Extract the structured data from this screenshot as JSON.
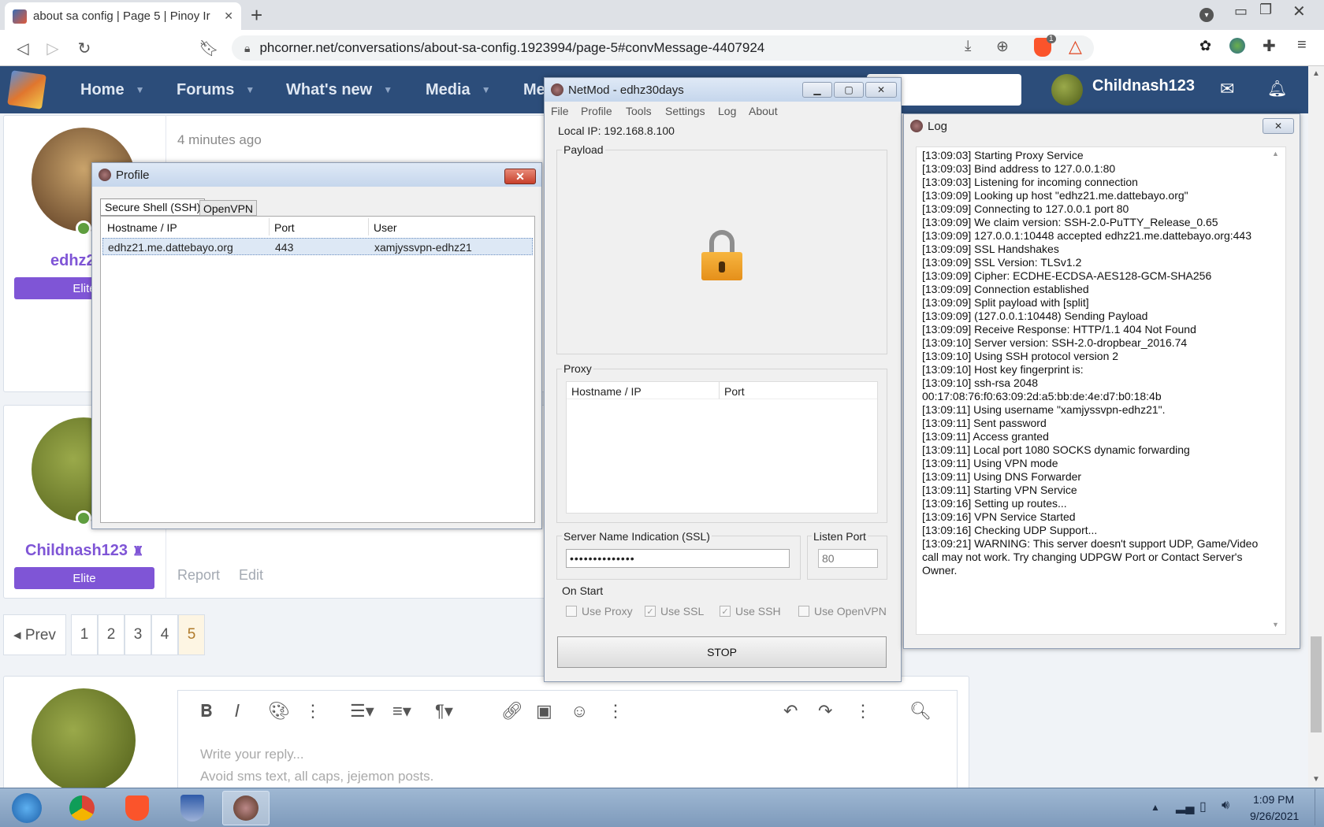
{
  "browser": {
    "tab_title": "about sa config | Page 5 | Pinoy Ir",
    "tab_close": "✕",
    "new_tab": "+",
    "url": "phcorner.net/conversations/about-sa-config.1923994/page-5#convMessage-4407924",
    "brave_count": "1"
  },
  "site": {
    "nav": [
      "Home",
      "Forums",
      "What's new",
      "Media",
      "Me"
    ],
    "username": "Childnash123",
    "post1": {
      "time": "4 minutes ago",
      "user": "edhz2",
      "badge": "Elite"
    },
    "post2": {
      "user": "Childnash123",
      "badge": "Elite",
      "actions": [
        "Report",
        "Edit"
      ]
    },
    "pagination": {
      "prev": "◂ Prev",
      "pages": [
        "1",
        "2",
        "3",
        "4",
        "5"
      ],
      "current": "5"
    },
    "editor": {
      "placeholder1": "Write your reply...",
      "placeholder2": "Avoid sms text, all caps, jejemon posts."
    }
  },
  "profile_window": {
    "title": "Profile",
    "tabs": [
      "Secure Shell (SSH)",
      "OpenVPN"
    ],
    "columns": [
      "Hostname / IP",
      "Port",
      "User"
    ],
    "rows": [
      {
        "host": "edhz21.me.dattebayo.org",
        "port": "443",
        "user": "xamjyssvpn-edhz21"
      }
    ]
  },
  "netmod_window": {
    "title": "NetMod - edhz30days",
    "menu": [
      "File",
      "Profile",
      "Tools",
      "Settings",
      "Log",
      "About"
    ],
    "local_ip": "Local IP: 192.168.8.100",
    "payload_label": "Payload",
    "proxy_label": "Proxy",
    "proxy_columns": [
      "Hostname / IP",
      "Port"
    ],
    "sni_label": "Server Name Indication (SSL)",
    "sni_value": "••••••••••••••",
    "listen_port_label": "Listen Port",
    "listen_port_placeholder": "80",
    "on_start_label": "On Start",
    "options": [
      {
        "label": "Use Proxy",
        "checked": false
      },
      {
        "label": "Use SSL",
        "checked": true
      },
      {
        "label": "Use SSH",
        "checked": true
      },
      {
        "label": "Use OpenVPN",
        "checked": false
      }
    ],
    "stop_label": "STOP"
  },
  "log_window": {
    "title": "Log",
    "lines": [
      "[13:09:03] Starting Proxy Service",
      "[13:09:03] Bind address to 127.0.0.1:80",
      "[13:09:03] Listening for incoming connection",
      "[13:09:09] Looking up host \"edhz21.me.dattebayo.org\"",
      "[13:09:09] Connecting to 127.0.0.1 port 80",
      "[13:09:09] We claim version: SSH-2.0-PuTTY_Release_0.65",
      "[13:09:09] 127.0.0.1:10448 accepted edhz21.me.dattebayo.org:443",
      "[13:09:09] SSL Handshakes",
      "[13:09:09] SSL Version: TLSv1.2",
      "[13:09:09] Cipher: ECDHE-ECDSA-AES128-GCM-SHA256",
      "[13:09:09] Connection established",
      "[13:09:09] Split payload with [split]",
      "[13:09:09] (127.0.0.1:10448) Sending Payload",
      "[13:09:09] Receive Response: HTTP/1.1 404 Not Found",
      "[13:09:10] Server version: SSH-2.0-dropbear_2016.74",
      "[13:09:10] Using SSH protocol version 2",
      "[13:09:10] Host key fingerprint is:",
      "[13:09:10] ssh-rsa 2048",
      "00:17:08:76:f0:63:09:2d:a5:bb:de:4e:d7:b0:18:4b",
      "[13:09:11] Using username \"xamjyssvpn-edhz21\".",
      "[13:09:11] Sent password",
      "[13:09:11] Access granted",
      "[13:09:11] Local port 1080 SOCKS dynamic forwarding",
      "[13:09:11] Using VPN mode",
      "[13:09:11] Using DNS Forwarder",
      "[13:09:11] Starting VPN Service",
      "[13:09:16] Setting up routes...",
      "[13:09:16] VPN Service Started",
      "[13:09:16] Checking UDP Support...",
      "[13:09:21] WARNING: This server doesn't support UDP, Game/Video\ncall may not work. Try changing UDPGW Port or Contact Server's\nOwner."
    ]
  },
  "taskbar": {
    "time": "1:09 PM",
    "date": "9/26/2021"
  },
  "colors": {
    "nav": "#2c4d7a",
    "badge": "#7f55d6",
    "lock": "#f2a530"
  }
}
